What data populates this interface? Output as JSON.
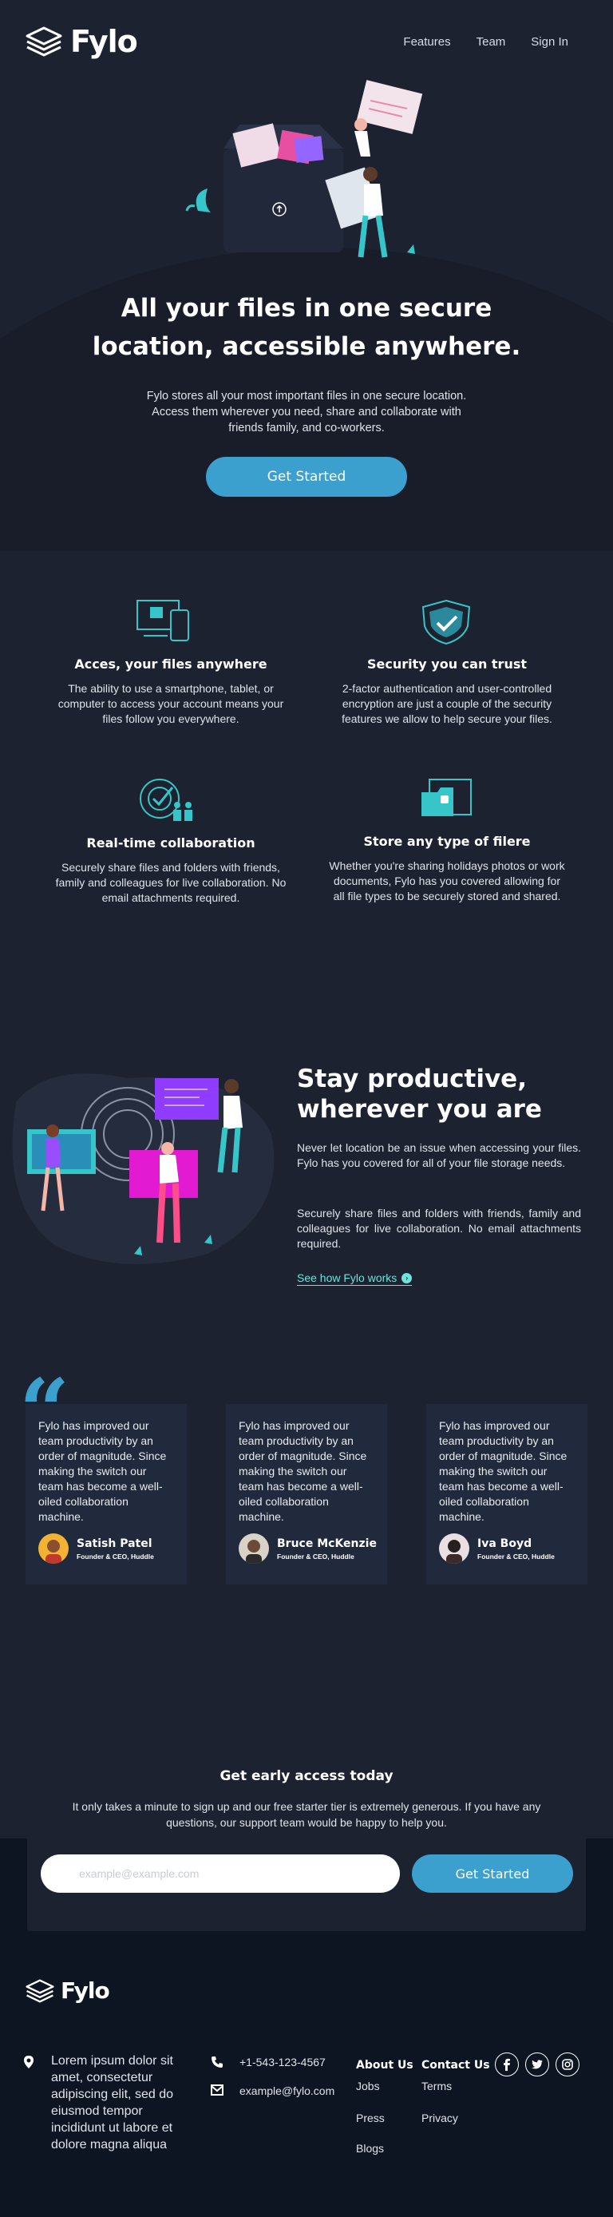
{
  "brand": {
    "name": "Fylo"
  },
  "nav": {
    "features": "Features",
    "team": "Team",
    "signin": "Sign In"
  },
  "hero": {
    "title": "All your files in one secure location, accessible anywhere.",
    "text": "Fylo stores all your most important files in one secure location. Access them wherever you need, share and collaborate with friends family, and co-workers.",
    "cta": "Get Started"
  },
  "features": [
    {
      "title": "Acces, your files anywhere",
      "text": "The ability to use a smartphone, tablet, or computer to access your account means your files follow you everywhere."
    },
    {
      "title": "Security you can trust",
      "text": "2-factor authentication and user-controlled encryption are just a couple of the security features we allow to help secure your files."
    },
    {
      "title": "Real-time collaboration",
      "text": "Securely share files and folders with friends, family and colleagues for live collaboration. No email attachments required."
    },
    {
      "title": "Store any type of filere",
      "text": "Whether you're sharing holidays photos or work documents, Fylo has you covered allowing for all file types to be securely stored and shared."
    }
  ],
  "productive": {
    "title": "Stay productive, wherever you are",
    "p1": "Never let location be an issue when accessing your files. Fylo has you covered for all of your file storage needs.",
    "p2": "Securely share files and folders with friends, family and colleagues for live collaboration. No email attachments required.",
    "link": "See how Fylo works"
  },
  "testimonials": [
    {
      "text": "Fylo has improved our team productivity by an order of magnitude. Since making the switch our team has become a well-oiled collaboration machine.",
      "name": "Satish Patel",
      "role": "Founder & CEO, Huddle"
    },
    {
      "text": "Fylo has improved our team productivity by an order of magnitude. Since making the switch our team has become a well-oiled collaboration machine.",
      "name": "Bruce McKenzie",
      "role": "Founder & CEO, Huddle"
    },
    {
      "text": "Fylo has improved our team productivity by an order of magnitude. Since making the switch our team has become a well-oiled collaboration machine.",
      "name": "Iva Boyd",
      "role": "Founder & CEO, Huddle"
    }
  ],
  "signup": {
    "title": "Get early access today",
    "text": "It only takes a minute to sign up and our free starter tier is extremely generous. If you have any questions, our support team would be happy to help you.",
    "placeholder": "example@example.com",
    "button": "Get Started"
  },
  "footer": {
    "address": "Lorem ipsum dolor sit amet, consectetur adipiscing elit, sed do eiusmod tempor incididunt ut labore et dolore magna aliqua",
    "phone": "+1-543-123-4567",
    "email": "example@fylo.com",
    "col1_head": "About Us",
    "col1": [
      "Jobs",
      "Press",
      "Blogs"
    ],
    "col2_head": "Contact Us",
    "col2": [
      "Terms",
      "Privacy"
    ],
    "social": [
      "facebook-icon",
      "twitter-icon",
      "instagram-icon"
    ]
  },
  "colors": {
    "bg": "#1c2230",
    "footer": "#0d1523",
    "accent": "#3ba0ce",
    "link": "#6ce5d8"
  }
}
